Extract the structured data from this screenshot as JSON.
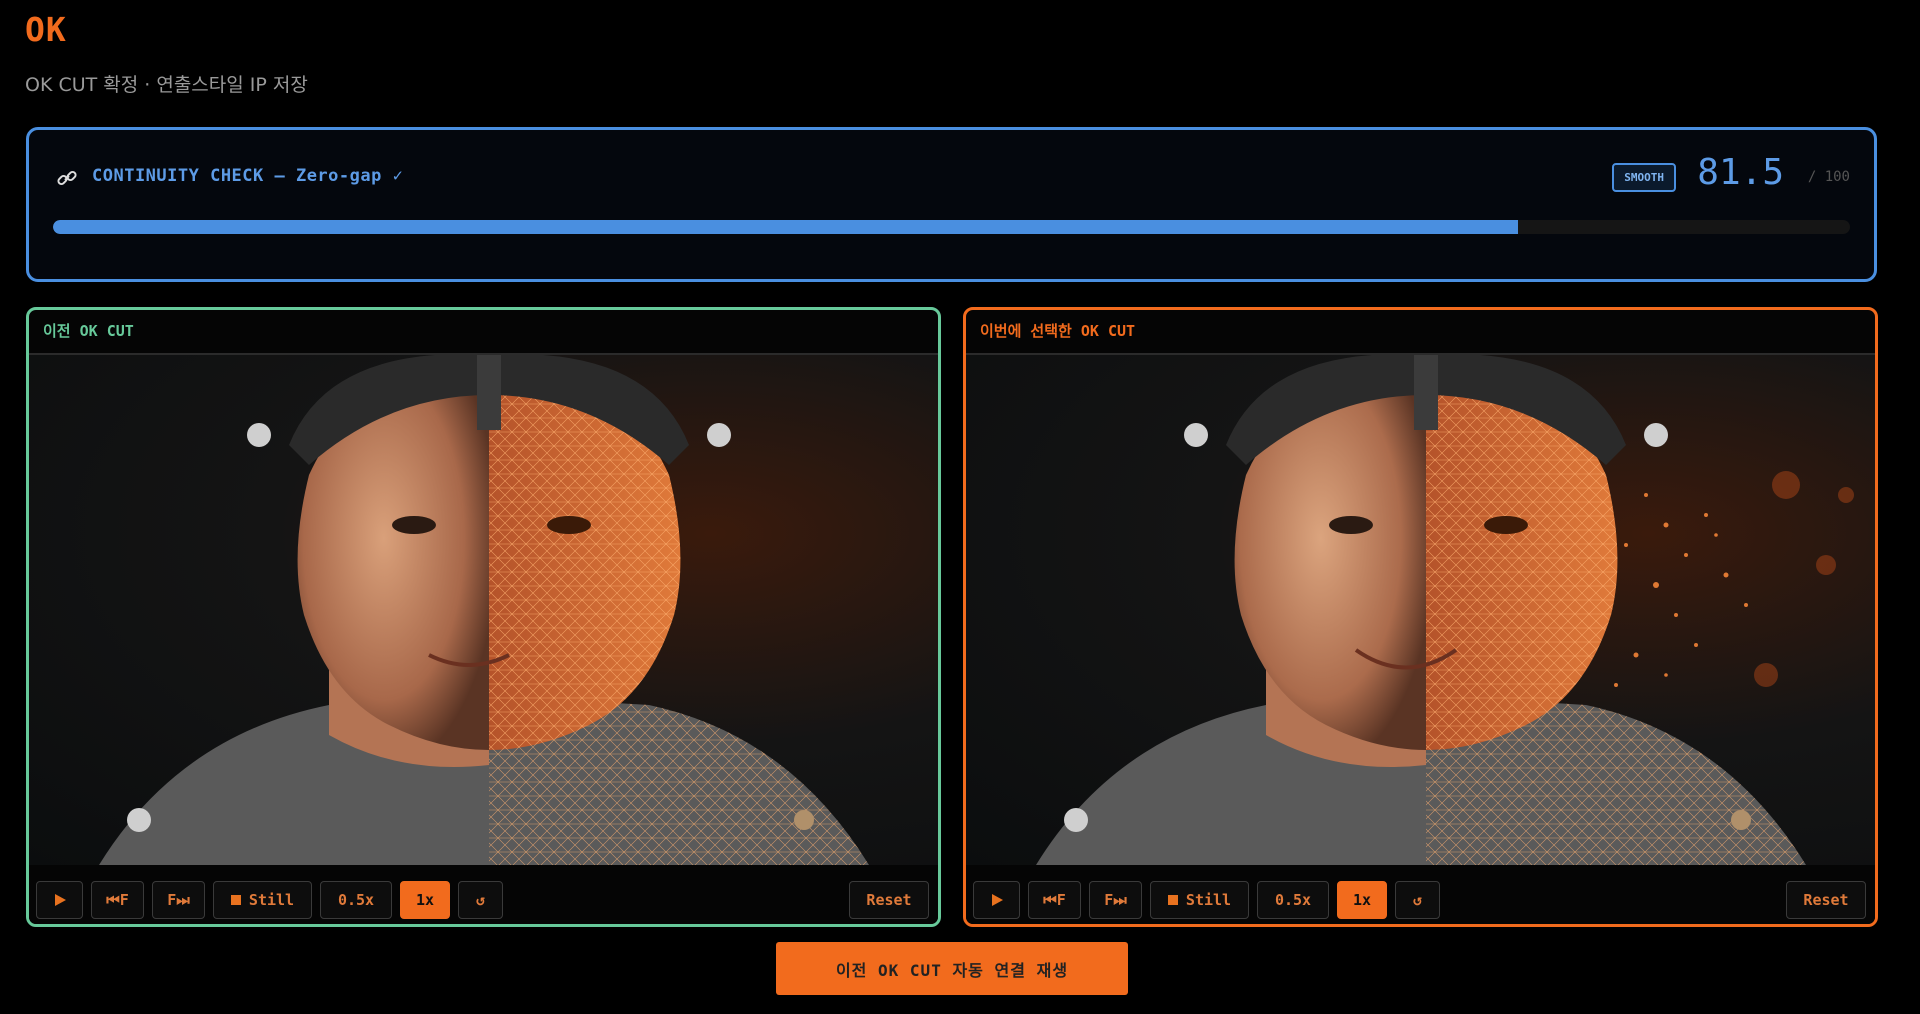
{
  "header": {
    "title": "OK",
    "subtitle": "OK CUT 확정 · 연출스타일 IP 저장"
  },
  "continuity": {
    "title": "CONTINUITY CHECK — Zero-gap ✓",
    "badge": "SMOOTH",
    "score": "81.5",
    "max": "/ 100",
    "progress_fraction": 0.815,
    "color": "#4a8fe0"
  },
  "panels": [
    {
      "title": "이전 OK CUT",
      "border_color": "#67c99a",
      "image": "face-half-mesh-portrait",
      "controls": {
        "play_icon": "play-icon",
        "prev_kf": "⏮F",
        "next_kf": "F⏭",
        "still": "Still",
        "speed_half": "0.5x",
        "speed_one": "1x",
        "loop_icon": "loop-icon",
        "reset": "Reset"
      }
    },
    {
      "title": "이번에 선택한 OK CUT",
      "border_color": "#f26b1d",
      "image": "face-half-mesh-particles-portrait",
      "controls": {
        "play_icon": "play-icon",
        "prev_kf": "⏮F",
        "next_kf": "F⏭",
        "still": "Still",
        "speed_half": "0.5x",
        "speed_one": "1x",
        "loop_icon": "loop-icon",
        "reset": "Reset"
      }
    }
  ],
  "bottom_button": "이전 OK CUT 자동 연결 재생",
  "accent": "#f26b1d"
}
